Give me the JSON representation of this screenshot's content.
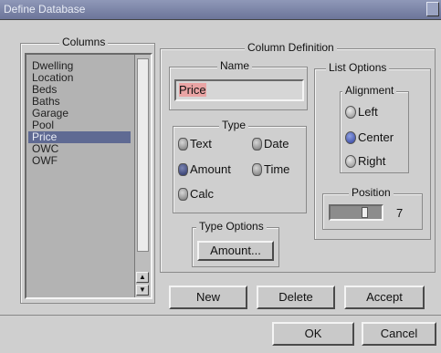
{
  "window": {
    "title": "Define Database"
  },
  "columns": {
    "legend": "Columns",
    "items": [
      "Dwelling",
      "Location",
      "Beds",
      "Baths",
      "Garage",
      "Pool",
      "Price",
      "OWC",
      "OWF"
    ],
    "selected_index": 6
  },
  "column_definition": {
    "legend": "Column Definition",
    "name": {
      "legend": "Name",
      "value": "Price"
    },
    "type": {
      "legend": "Type",
      "options": [
        "Text",
        "Date",
        "Amount",
        "Time",
        "Calc"
      ],
      "selected": "Amount"
    },
    "type_options": {
      "legend": "Type Options",
      "button_label": "Amount..."
    }
  },
  "list_options": {
    "legend": "List Options",
    "alignment": {
      "legend": "Alignment",
      "options": [
        "Left",
        "Center",
        "Right"
      ],
      "selected": "Center"
    },
    "position": {
      "legend": "Position",
      "value": "7",
      "level_fraction": 0.7
    }
  },
  "buttons": {
    "new": "New",
    "delete": "Delete",
    "accept": "Accept",
    "ok": "OK",
    "cancel": "Cancel"
  },
  "colors": {
    "selection": "#5f6a93",
    "titlebar": "#6c7599",
    "background": "#cfcfcf"
  }
}
